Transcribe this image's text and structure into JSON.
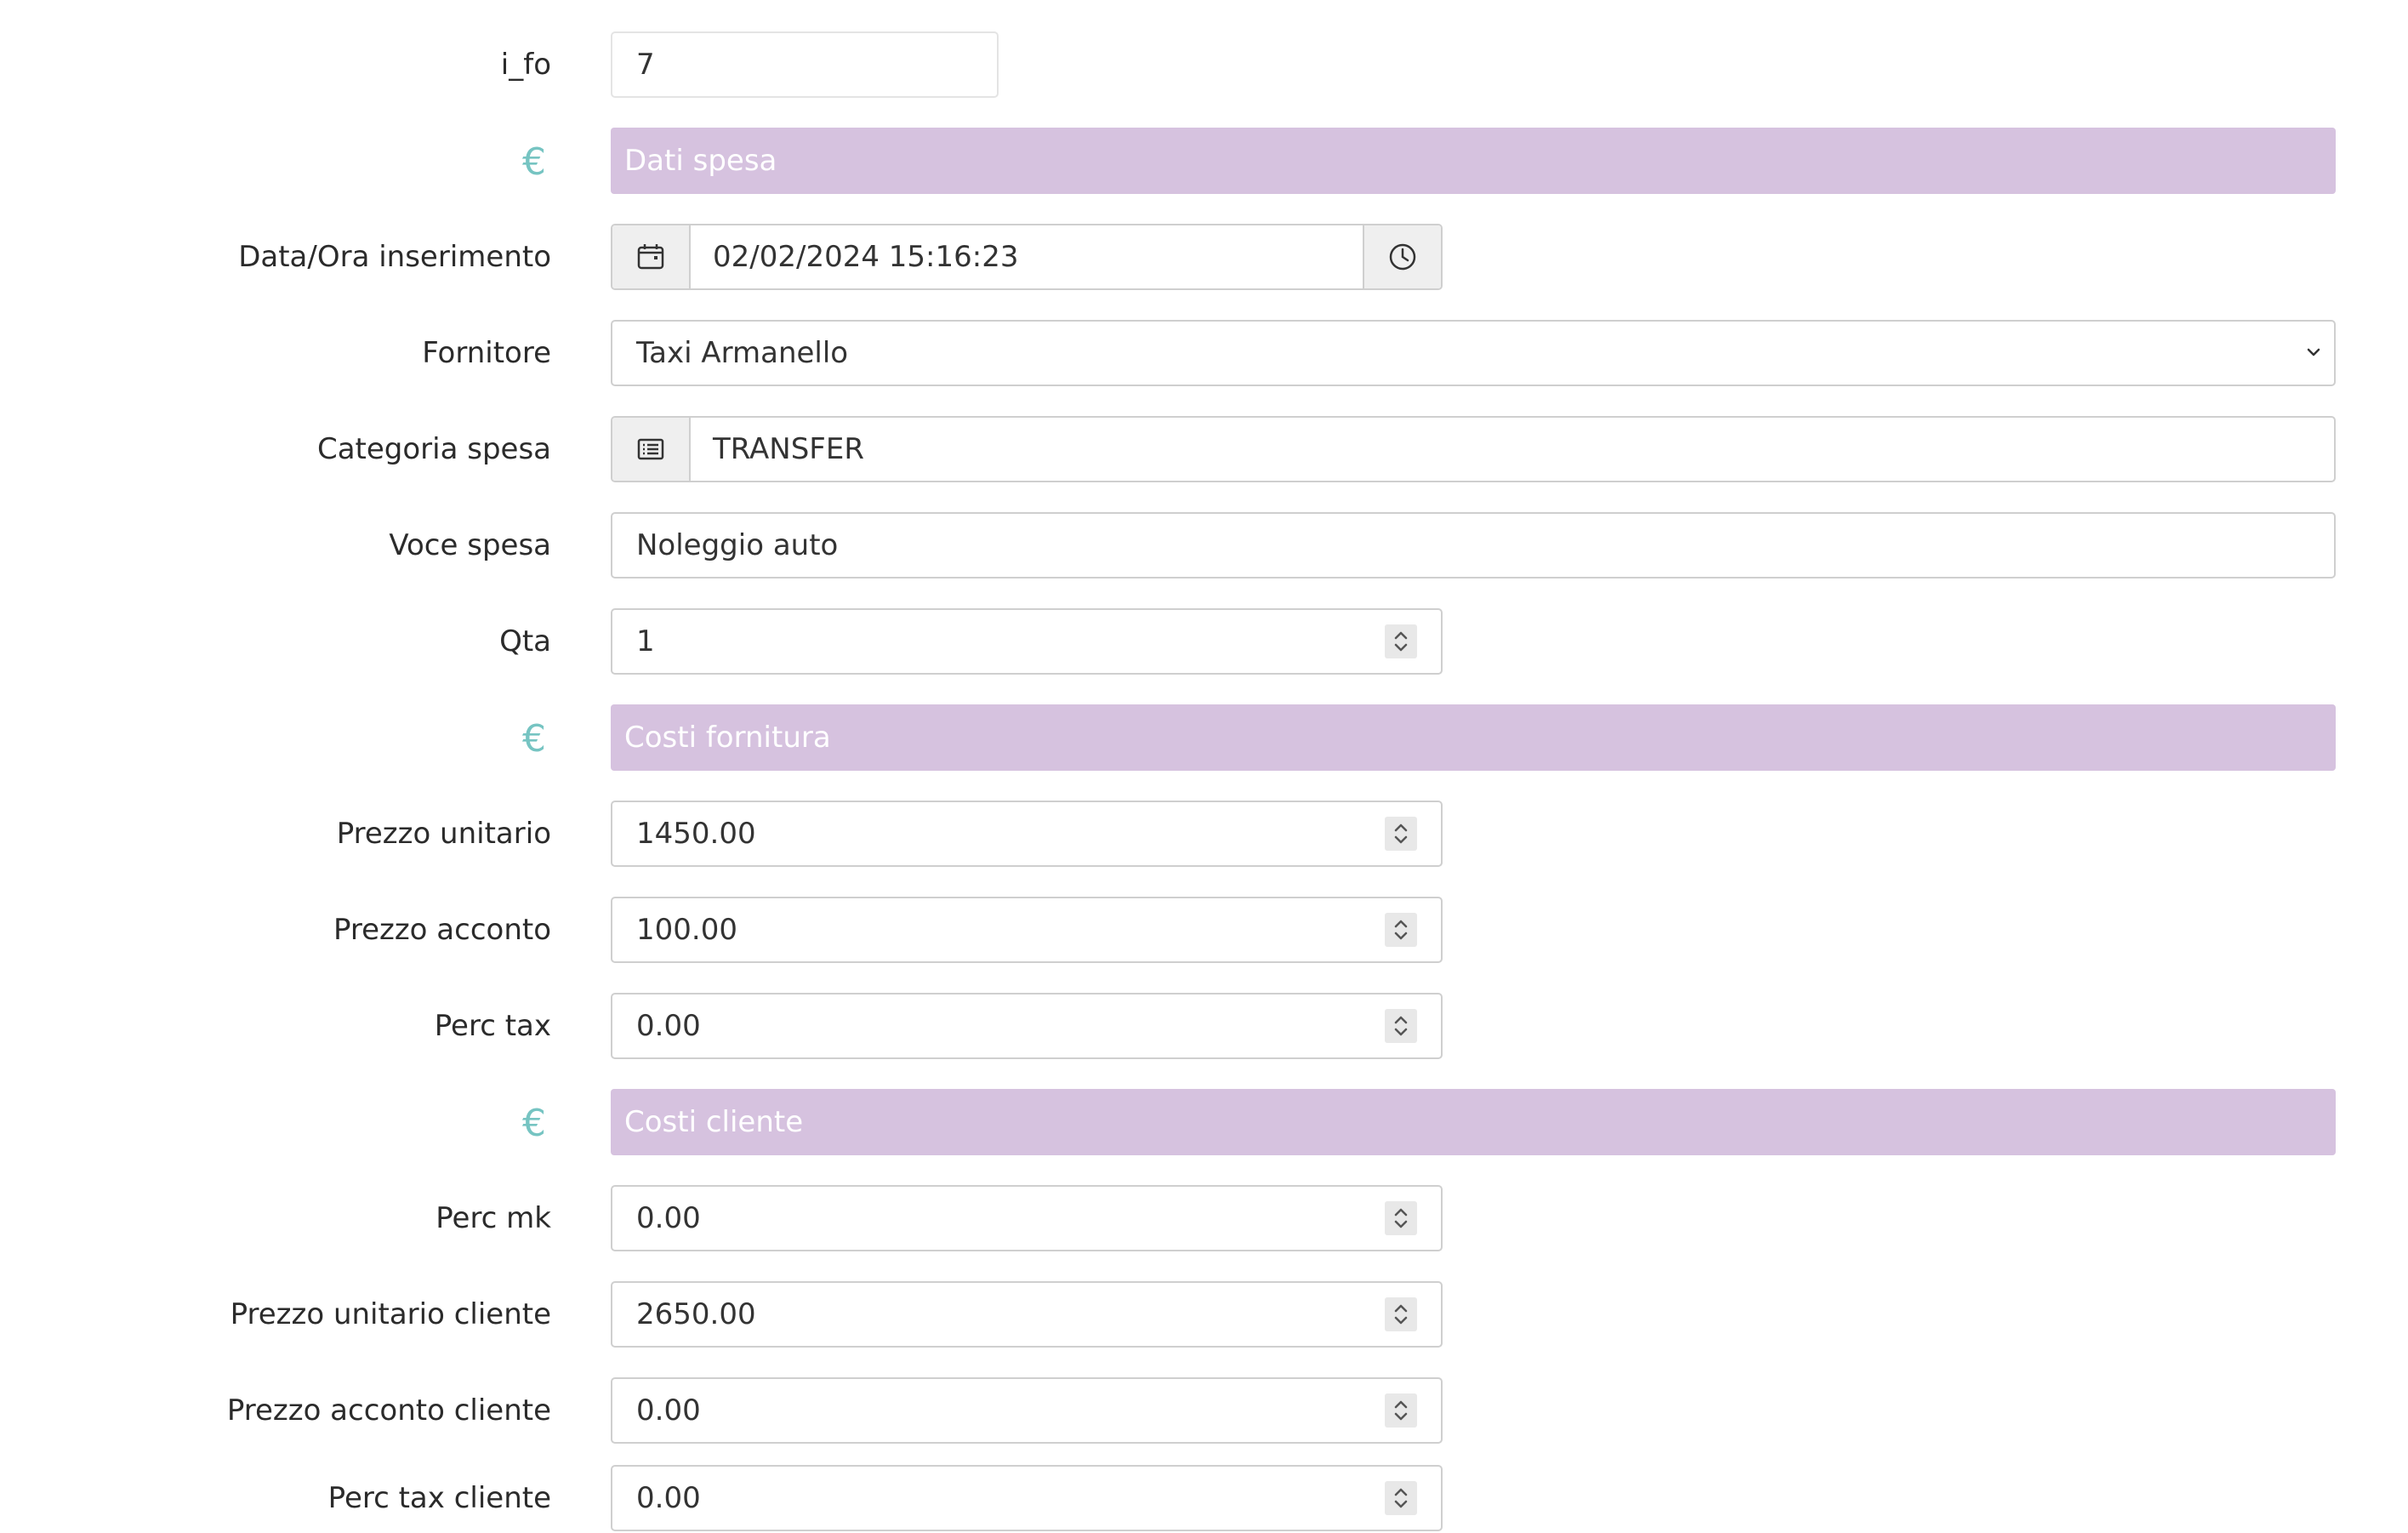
{
  "form": {
    "id_field": {
      "label": "i_fo",
      "value": "7"
    },
    "section_dati": {
      "title": "Dati spesa",
      "icon": "euro-icon"
    },
    "data_ora": {
      "label": "Data/Ora inserimento",
      "value": "02/02/2024 15:16:23"
    },
    "fornitore": {
      "label": "Fornitore",
      "value": "Taxi Armanello"
    },
    "categoria": {
      "label": "Categoria spesa",
      "value": "TRANSFER"
    },
    "voce": {
      "label": "Voce spesa",
      "value": "Noleggio auto"
    },
    "qta": {
      "label": "Qta",
      "value": "1"
    },
    "section_fornitura": {
      "title": "Costi fornitura",
      "icon": "euro-icon"
    },
    "prezzo_unitario": {
      "label": "Prezzo unitario",
      "value": "1450.00"
    },
    "prezzo_acconto": {
      "label": "Prezzo acconto",
      "value": "100.00"
    },
    "perc_tax": {
      "label": "Perc tax",
      "value": "0.00"
    },
    "section_cliente": {
      "title": "Costi cliente",
      "icon": "euro-icon"
    },
    "perc_mk": {
      "label": "Perc mk",
      "value": "0.00"
    },
    "prezzo_unitario_cliente": {
      "label": "Prezzo unitario cliente",
      "value": "2650.00"
    },
    "prezzo_acconto_cliente": {
      "label": "Prezzo acconto cliente",
      "value": "0.00"
    },
    "perc_tax_cliente": {
      "label": "Perc tax cliente",
      "value": "0.00"
    }
  },
  "colors": {
    "section_bg": "#d6c2df",
    "euro_icon": "#76c4c2",
    "addon_bg": "#efefef",
    "border": "#cfcfcf"
  }
}
